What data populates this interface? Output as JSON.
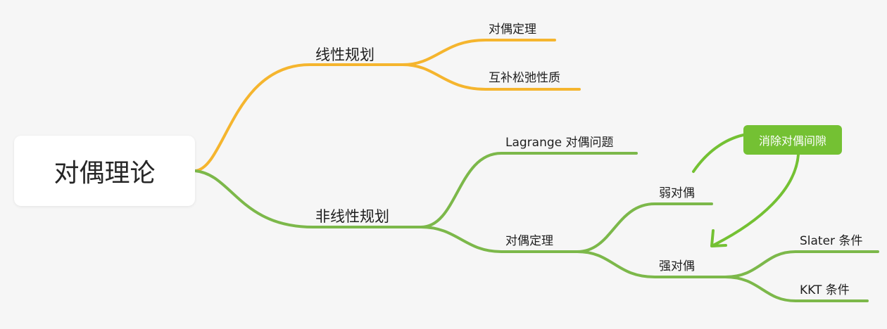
{
  "root": {
    "label": "对偶理论"
  },
  "branches": {
    "linear": {
      "label": "线性规划",
      "color": "#f5b52e",
      "children": [
        "对偶定理",
        "互补松弛性质"
      ]
    },
    "nonlinear": {
      "label": "非线性规划",
      "color": "#7cb84a",
      "children": {
        "lagrange": "Lagrange 对偶问题",
        "duality_theorem": {
          "label": "对偶定理",
          "weak": "弱对偶",
          "strong": {
            "label": "强对偶",
            "children": [
              "Slater 条件",
              "KKT 条件"
            ]
          }
        }
      }
    }
  },
  "callout": {
    "label": "消除对偶间隙",
    "color": "#74c133"
  }
}
